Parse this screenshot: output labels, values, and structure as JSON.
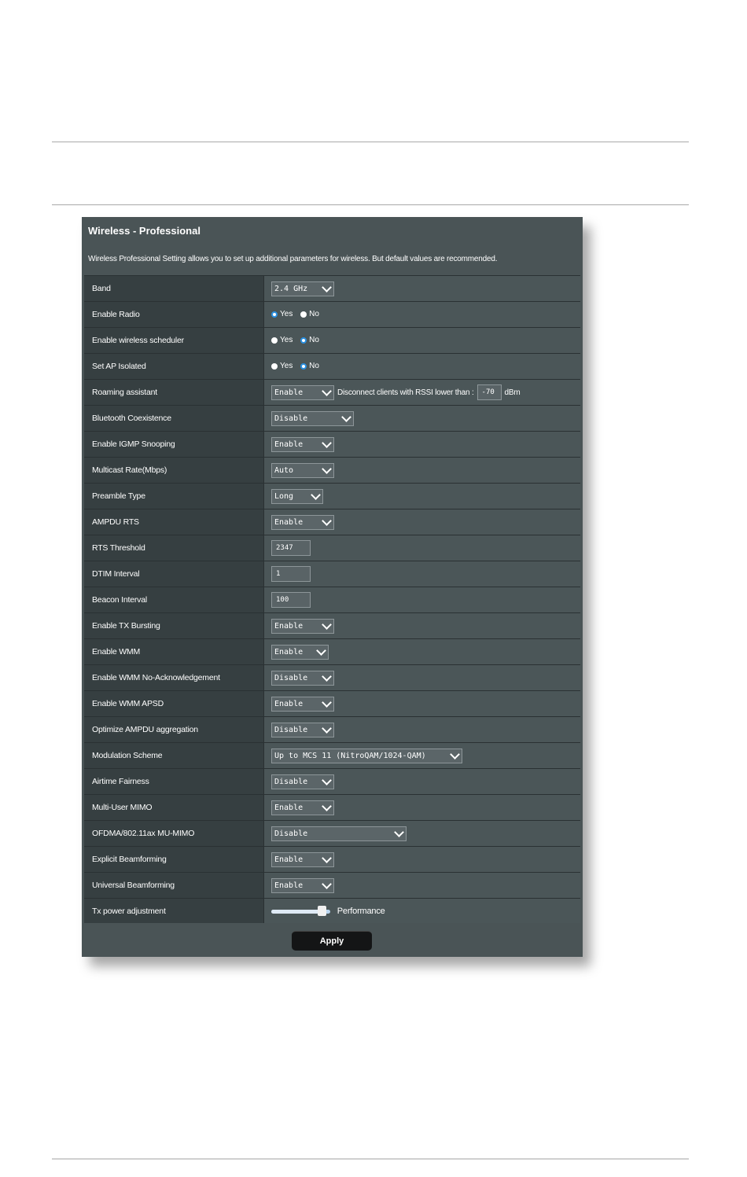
{
  "panel": {
    "title": "Wireless - Professional",
    "description": "Wireless Professional Setting allows you to set up additional parameters for wireless. But default values are recommended."
  },
  "rows": {
    "band": {
      "label": "Band",
      "value": "2.4 GHz"
    },
    "enable_radio": {
      "label": "Enable Radio",
      "selected": "Yes"
    },
    "scheduler": {
      "label": "Enable wireless scheduler",
      "selected": "No"
    },
    "ap_isolated": {
      "label": "Set AP Isolated",
      "selected": "No"
    },
    "roaming": {
      "label": "Roaming assistant",
      "value": "Enable",
      "text": "Disconnect clients with RSSI lower than :",
      "rssi": "-70",
      "unit": "dBm"
    },
    "bluetooth": {
      "label": "Bluetooth Coexistence",
      "value": "Disable"
    },
    "igmp": {
      "label": "Enable IGMP Snooping",
      "value": "Enable"
    },
    "multicast": {
      "label": "Multicast Rate(Mbps)",
      "value": "Auto"
    },
    "preamble": {
      "label": "Preamble Type",
      "value": "Long"
    },
    "ampdu_rts": {
      "label": "AMPDU RTS",
      "value": "Enable"
    },
    "rts_threshold": {
      "label": "RTS Threshold",
      "value": "2347"
    },
    "dtim": {
      "label": "DTIM Interval",
      "value": "1"
    },
    "beacon": {
      "label": "Beacon Interval",
      "value": "100"
    },
    "tx_bursting": {
      "label": "Enable TX Bursting",
      "value": "Enable"
    },
    "wmm": {
      "label": "Enable WMM",
      "value": "Enable"
    },
    "wmm_noack": {
      "label": "Enable WMM No-Acknowledgement",
      "value": "Disable"
    },
    "wmm_apsd": {
      "label": "Enable WMM APSD",
      "value": "Enable"
    },
    "ampdu_agg": {
      "label": "Optimize AMPDU aggregation",
      "value": "Disable"
    },
    "modulation": {
      "label": "Modulation Scheme",
      "value": "Up to MCS 11 (NitroQAM/1024-QAM)"
    },
    "airtime": {
      "label": "Airtime Fairness",
      "value": "Disable"
    },
    "mu_mimo": {
      "label": "Multi-User MIMO",
      "value": "Enable"
    },
    "ofdma": {
      "label": "OFDMA/802.11ax MU-MIMO",
      "value": "Disable"
    },
    "explicit_bf": {
      "label": "Explicit Beamforming",
      "value": "Enable"
    },
    "universal_bf": {
      "label": "Universal Beamforming",
      "value": "Enable"
    },
    "tx_power": {
      "label": "Tx power adjustment",
      "level_text": "Performance",
      "level_fraction": 0.9
    }
  },
  "radio_options": {
    "yes": "Yes",
    "no": "No"
  },
  "apply_label": "Apply",
  "colors": {
    "panel": "#4a5456",
    "label_cell": "#363f41",
    "radio_selected": "#2a8fe0"
  }
}
